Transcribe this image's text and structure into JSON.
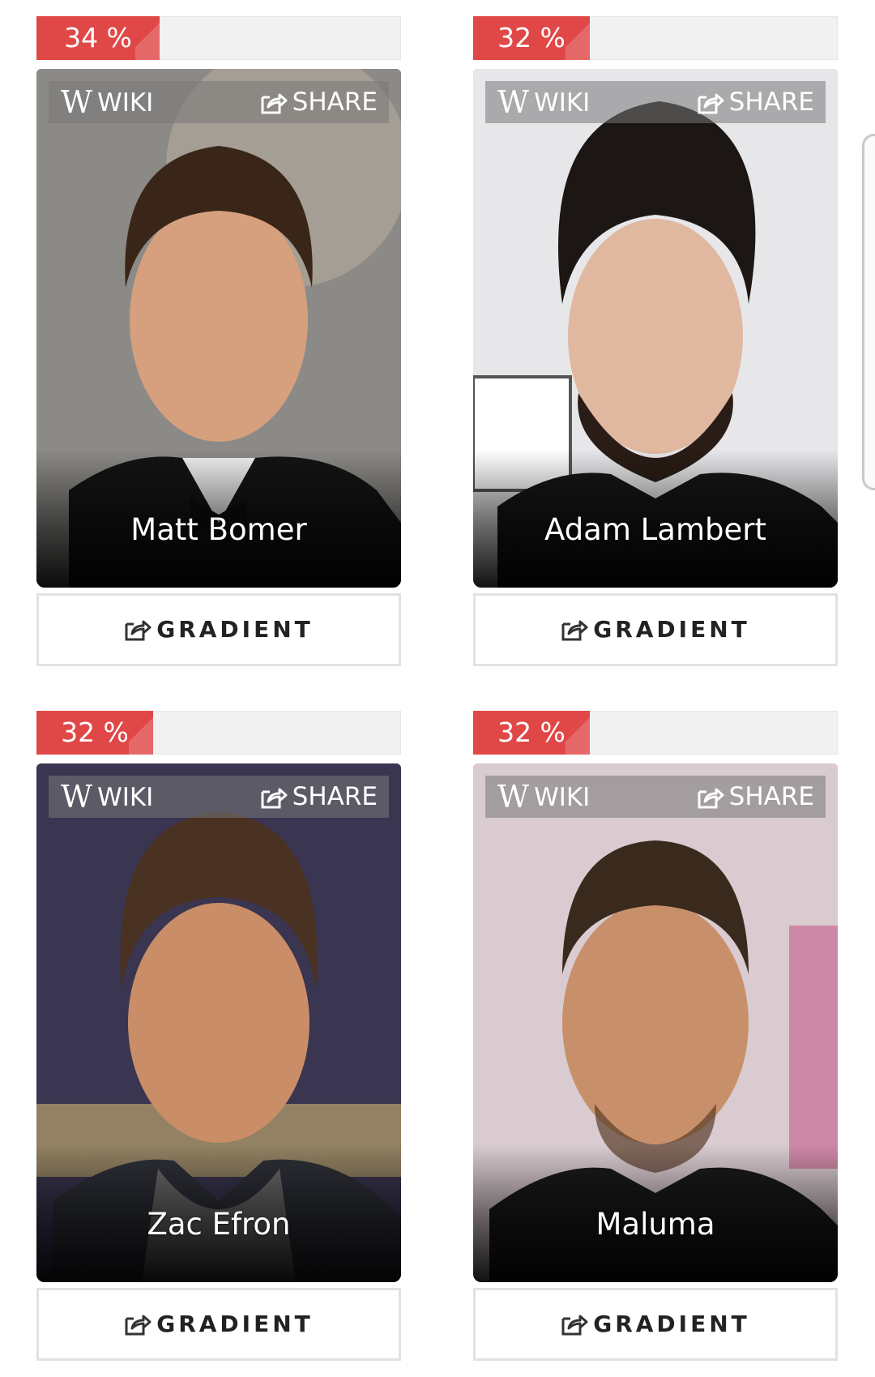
{
  "cards": [
    {
      "match": "34 %",
      "match_fraction": 0.34,
      "name": "Matt Bomer",
      "wiki_label": "WIKI",
      "share_label": "SHARE",
      "button_label": "GRADIENT"
    },
    {
      "match": "32 %",
      "match_fraction": 0.32,
      "name": "Adam Lambert",
      "wiki_label": "WIKI",
      "share_label": "SHARE",
      "button_label": "GRADIENT"
    },
    {
      "match": "32 %",
      "match_fraction": 0.32,
      "name": "Zac Efron",
      "wiki_label": "WIKI",
      "share_label": "SHARE",
      "button_label": "GRADIENT"
    },
    {
      "match": "32 %",
      "match_fraction": 0.32,
      "name": "Maluma",
      "wiki_label": "WIKI",
      "share_label": "SHARE",
      "button_label": "GRADIENT"
    }
  ],
  "icons": {
    "wiki": "wikipedia-w-icon",
    "share": "share-icon"
  },
  "colors": {
    "badge": "#e04848",
    "button_border": "#e2e2e2",
    "button_text": "#222222"
  }
}
